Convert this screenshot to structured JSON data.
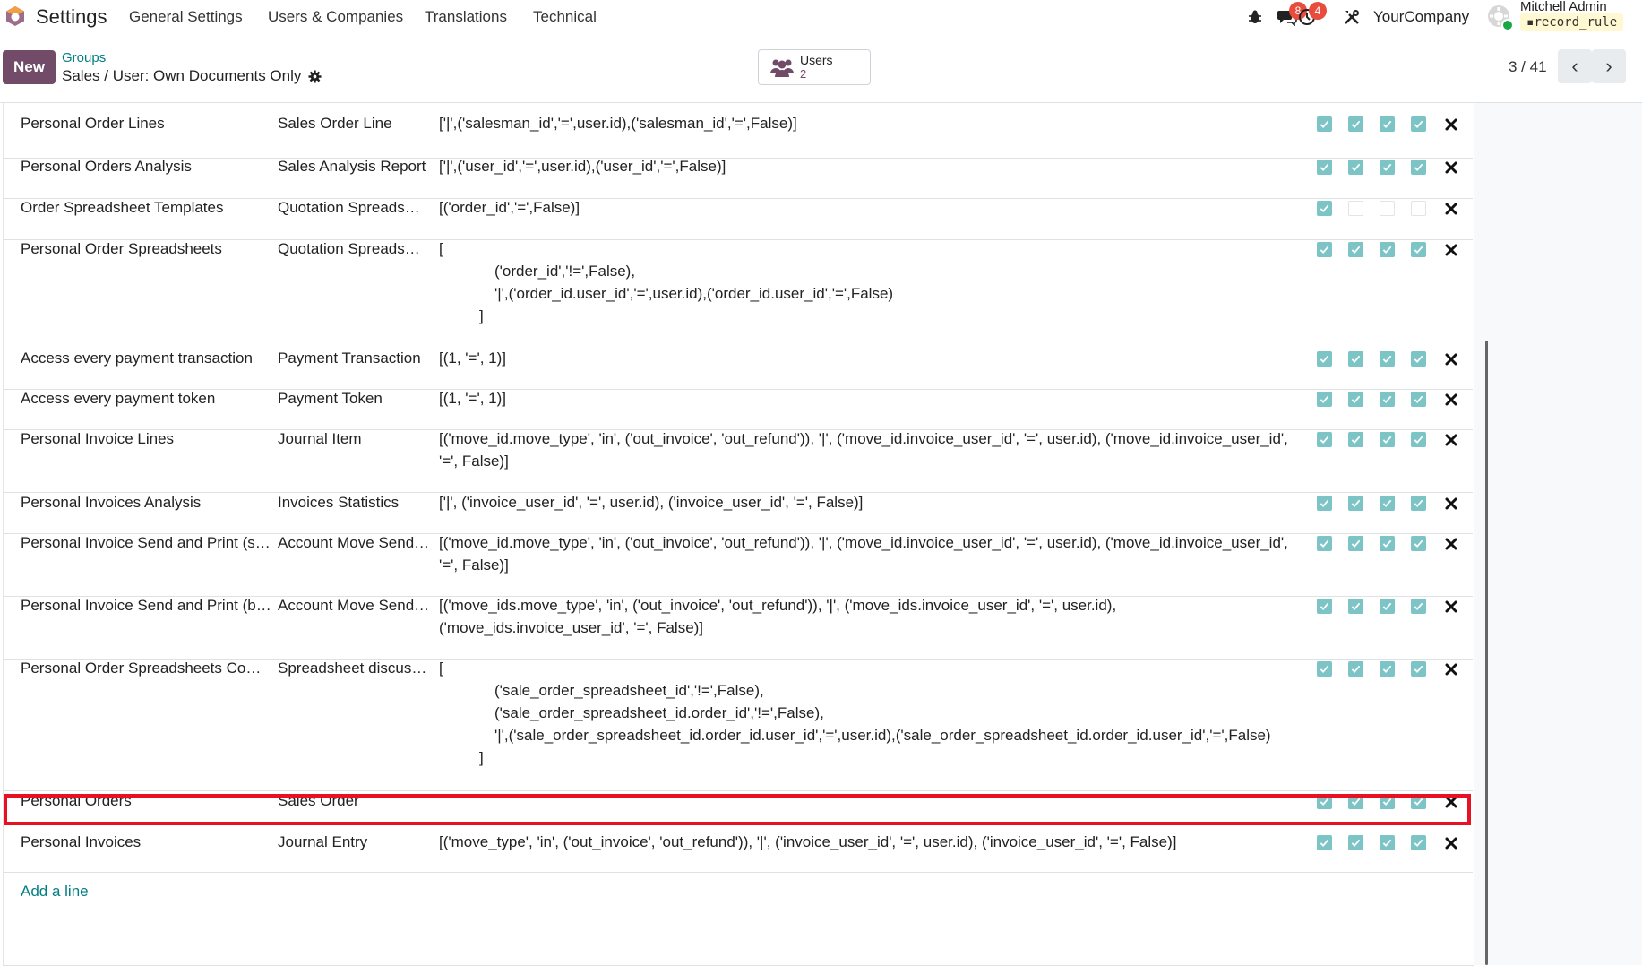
{
  "navbar": {
    "app_name": "Settings",
    "menus": [
      "General Settings",
      "Users & Companies",
      "Translations",
      "Technical"
    ],
    "messages_badge": "8",
    "activities_badge": "4",
    "company": "YourCompany",
    "user_name": "Mitchell Admin",
    "database": "record_rule",
    "icons": [
      "odoo-logo-icon",
      "bug-icon",
      "chat-icon",
      "clock-icon",
      "tools-icon",
      "avatar"
    ]
  },
  "control": {
    "new_label": "New",
    "breadcrumb": "Groups",
    "record_title": "Sales / User: Own Documents Only",
    "smart_button": {
      "label": "Users",
      "count": "2"
    },
    "pager": "3 / 41"
  },
  "rules": [
    {
      "name": "Personal Order Lines",
      "model": "Sales Order Line",
      "domain": [
        "['|',('salesman_id','=',user.id),('salesman_id','=',False)]"
      ],
      "perms": [
        true,
        true,
        true,
        true
      ]
    },
    {
      "name": "Personal Orders Analysis",
      "model": "Sales Analysis Report",
      "domain": [
        "['|',('user_id','=',user.id),('user_id','=',False)]"
      ],
      "perms": [
        true,
        true,
        true,
        true
      ]
    },
    {
      "name": "Order Spreadsheet Templates",
      "model": "Quotation Spreads…",
      "domain": [
        "[('order_id','=',False)]"
      ],
      "perms": [
        true,
        false,
        false,
        false
      ]
    },
    {
      "name": "Personal Order Spreadsheets",
      "model": "Quotation Spreads…",
      "domain": [
        "[",
        "('order_id','!=',False),",
        "'|',('order_id.user_id','=',user.id),('order_id.user_id','=',False)",
        "]"
      ],
      "perms": [
        true,
        true,
        true,
        true
      ]
    },
    {
      "name": "Access every payment transaction",
      "model": "Payment Transaction",
      "domain": [
        "[(1, '=', 1)]"
      ],
      "perms": [
        true,
        true,
        true,
        true
      ]
    },
    {
      "name": "Access every payment token",
      "model": "Payment Token",
      "domain": [
        "[(1, '=', 1)]"
      ],
      "perms": [
        true,
        true,
        true,
        true
      ]
    },
    {
      "name": "Personal Invoice Lines",
      "model": "Journal Item",
      "domain": [
        "[('move_id.move_type', 'in', ('out_invoice', 'out_refund')), '|', ('move_id.invoice_user_id', '=', user.id), ('move_id.invoice_user_id',",
        "'=', False)]"
      ],
      "perms": [
        true,
        true,
        true,
        true
      ]
    },
    {
      "name": "Personal Invoices Analysis",
      "model": "Invoices Statistics",
      "domain": [
        "['|', ('invoice_user_id', '=', user.id), ('invoice_user_id', '=', False)]"
      ],
      "perms": [
        true,
        true,
        true,
        true
      ]
    },
    {
      "name": "Personal Invoice Send and Print (s…",
      "model": "Account Move Send…",
      "domain": [
        "[('move_id.move_type', 'in', ('out_invoice', 'out_refund')), '|', ('move_id.invoice_user_id', '=', user.id), ('move_id.invoice_user_id',",
        "'=', False)]"
      ],
      "perms": [
        true,
        true,
        true,
        true
      ]
    },
    {
      "name": "Personal Invoice Send and Print (b…",
      "model": "Account Move Send…",
      "domain": [
        "[('move_ids.move_type', 'in', ('out_invoice', 'out_refund')), '|', ('move_ids.invoice_user_id', '=', user.id),",
        "('move_ids.invoice_user_id', '=', False)]"
      ],
      "perms": [
        true,
        true,
        true,
        true
      ]
    },
    {
      "name": "Personal Order Spreadsheets Co…",
      "model": "Spreadsheet discus…",
      "domain": [
        "[",
        "('sale_order_spreadsheet_id','!=',False),",
        "('sale_order_spreadsheet_id.order_id','!=',False),",
        "'|',('sale_order_spreadsheet_id.order_id.user_id','=',user.id),('sale_order_spreadsheet_id.order_id.user_id','=',False)",
        "]"
      ],
      "perms": [
        true,
        true,
        true,
        true
      ]
    },
    {
      "name": "Personal Orders",
      "model": "Sales Order",
      "domain": [],
      "perms": [
        true,
        true,
        true,
        true
      ]
    },
    {
      "name": "Personal Invoices",
      "model": "Journal Entry",
      "domain": [
        "[('move_type', 'in', ('out_invoice', 'out_refund')), '|', ('invoice_user_id', '=', user.id), ('invoice_user_id', '=', False)]"
      ],
      "perms": [
        true,
        true,
        true,
        true
      ]
    }
  ],
  "add_line_label": "Add a line",
  "colors": {
    "brand": "#714b67",
    "link": "#017e84",
    "checkbox": "#7cc4c6",
    "highlight": "#e81123",
    "badge": "#e74c3c"
  }
}
